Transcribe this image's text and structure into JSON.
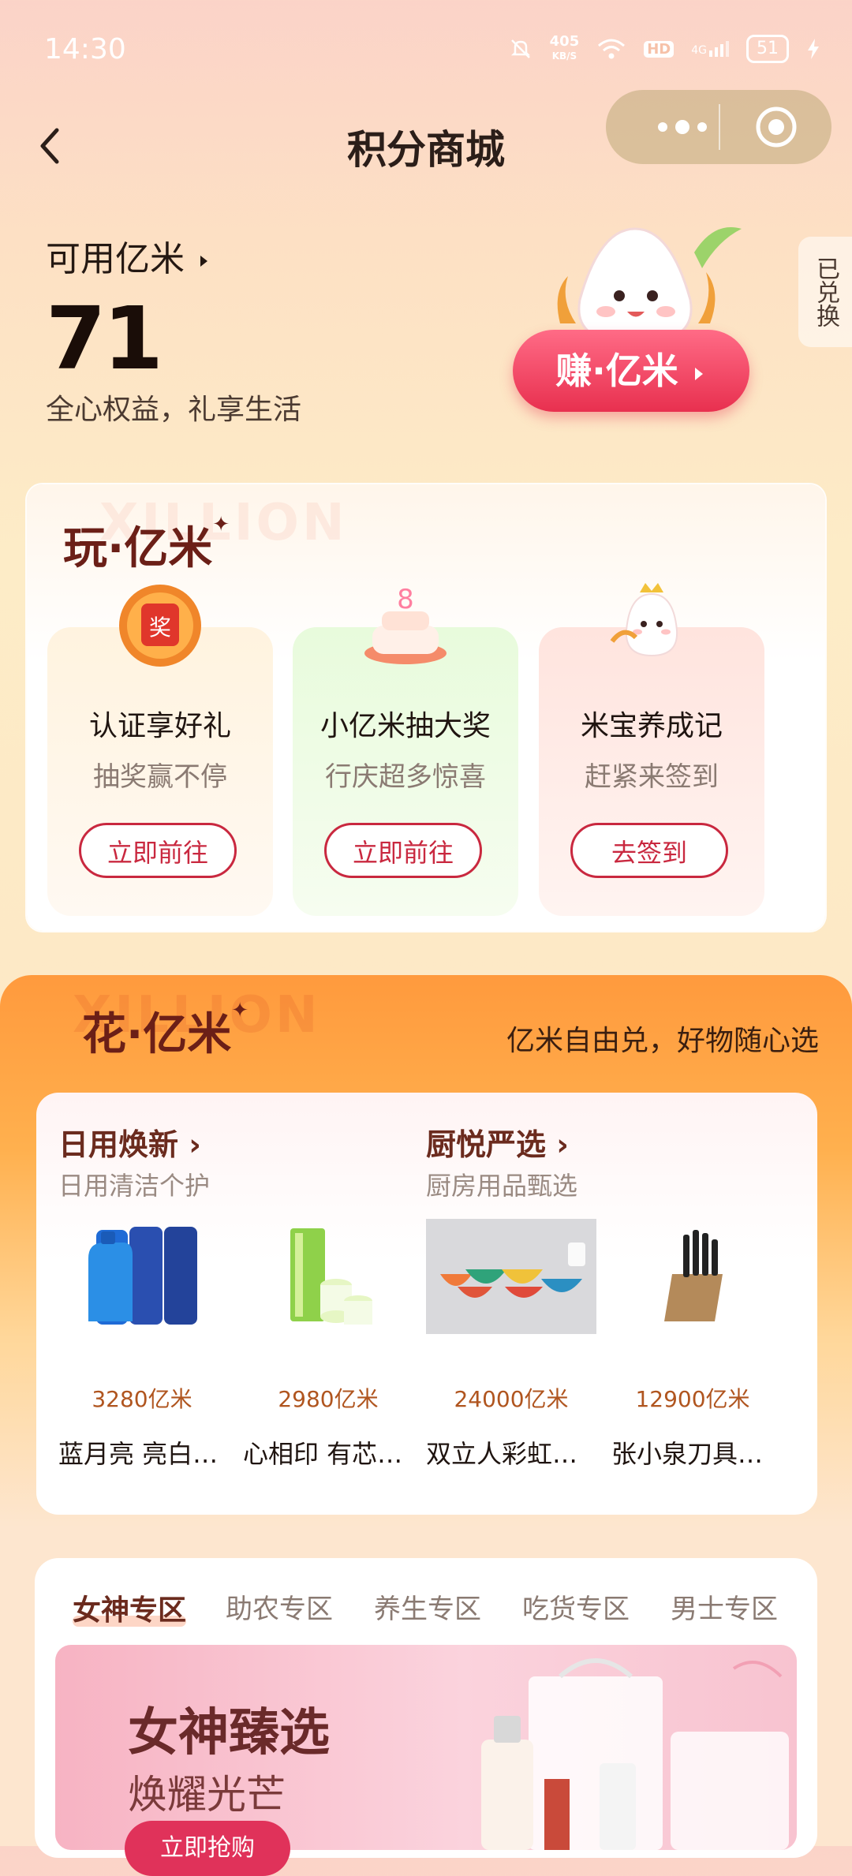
{
  "status_bar": {
    "time": "14:30",
    "net_speed": "405",
    "net_unit": "KB/S",
    "hd": "HD",
    "signal": "4G",
    "battery": "51"
  },
  "header": {
    "title": "积分商城",
    "back_icon": "chevron-left-icon",
    "more_icon": "more-dots-icon",
    "target_icon": "target-icon"
  },
  "points": {
    "label": "可用亿米",
    "value": "71",
    "slogan": "全心权益，礼享生活",
    "exchanged": "已兑换",
    "earn_button": "赚·亿米"
  },
  "play": {
    "title": "玩·亿米",
    "bg_word": "XILLION",
    "items": [
      {
        "name": "认证享好礼",
        "sub": "抽奖赢不停",
        "button": "立即前往",
        "icon": "prize-icon"
      },
      {
        "name": "小亿米抽大奖",
        "sub": "行庆超多惊喜",
        "button": "立即前往",
        "icon": "cake-icon"
      },
      {
        "name": "米宝养成记",
        "sub": "赶紧来签到",
        "button": "去签到",
        "icon": "mascot-icon"
      }
    ]
  },
  "spend": {
    "title": "花·亿米",
    "bg_word": "XILLION",
    "slogan": "亿米自由兑，好物随心选",
    "categories": [
      {
        "title": "日用焕新",
        "sub": "日用清洁个护"
      },
      {
        "title": "厨悦严选",
        "sub": "厨房用品甄选"
      }
    ],
    "products": [
      {
        "price": "3280亿米",
        "name": "蓝月亮 亮白…"
      },
      {
        "price": "2980亿米",
        "name": "心相印 有芯…"
      },
      {
        "price": "24000亿米",
        "name": "双立人彩虹…"
      },
      {
        "price": "12900亿米",
        "name": "张小泉刀具…"
      }
    ]
  },
  "zones": {
    "tabs": [
      "女神专区",
      "助农专区",
      "养生专区",
      "吃货专区",
      "男士专区"
    ],
    "banner": {
      "title": "女神臻选",
      "subtitle": "焕耀光芒",
      "button": "立即抢购"
    }
  },
  "colors": {
    "accent": "#c9283f",
    "earn": "#e8304f",
    "spend": "#ff9a3d"
  }
}
